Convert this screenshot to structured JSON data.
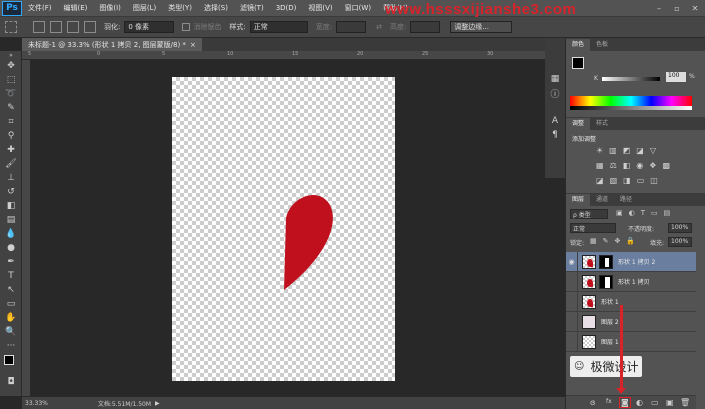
{
  "app": {
    "logo": "Ps",
    "menu": [
      "文件(F)",
      "编辑(E)",
      "图像(I)",
      "图层(L)",
      "类型(Y)",
      "选择(S)",
      "滤镜(T)",
      "3D(D)",
      "视图(V)",
      "窗口(W)",
      "帮助(H)"
    ],
    "watermark": "www.hsssxijianshe3.com",
    "window_controls": [
      "–",
      "▫",
      "✕"
    ]
  },
  "options": {
    "feather_label": "羽化:",
    "feather_value": "0 像素",
    "antialias_label": "消除锯齿",
    "style_label": "样式:",
    "style_value": "正常",
    "width_label": "宽度:",
    "height_label": "高度:",
    "refine_button": "调整边缘..."
  },
  "document": {
    "tab_title": "未标题-1 @ 33.3% (形状 1 拷贝 2, 图层蒙版/8) *",
    "tab_close": "×",
    "zoom": "33.33%",
    "doc_size": "文档:5.51M/1.50M",
    "shape_color": "#c0101e"
  },
  "ruler_top_ticks": [
    "5",
    "0",
    "5",
    "10",
    "15",
    "20",
    "25",
    "30",
    "35"
  ],
  "panels": {
    "color_tabs": [
      "颜色",
      "色板"
    ],
    "k_label": "K",
    "k_value": "100",
    "k_unit": "%",
    "adjust_tabs": [
      "调整",
      "样式"
    ],
    "adjust_title": "添加调整",
    "layers_tabs": [
      "图层",
      "通道",
      "路径"
    ],
    "filter_kind": "ρ 类型",
    "blend_mode": "正常",
    "opacity_label": "不透明度:",
    "opacity_value": "100%",
    "lock_label": "锁定:",
    "fill_label": "填充:",
    "fill_value": "100%",
    "layers": [
      {
        "name": "形状 1 拷贝 2",
        "visible": true,
        "selected": true
      },
      {
        "name": "形状 1 拷贝",
        "visible": false,
        "selected": false
      },
      {
        "name": "形状 1",
        "visible": false,
        "selected": false
      },
      {
        "name": "图层 2",
        "visible": false,
        "selected": false
      },
      {
        "name": "图层 1",
        "visible": false,
        "selected": false
      }
    ],
    "bottom_buttons": [
      "ɞ",
      "fx",
      "◙",
      "◐",
      "▭",
      "▣",
      "🗑"
    ]
  },
  "brand_overlay": {
    "text": "极微设计"
  },
  "colors": {
    "accent_red": "#d9232a",
    "selection": "#6a7ea0"
  }
}
